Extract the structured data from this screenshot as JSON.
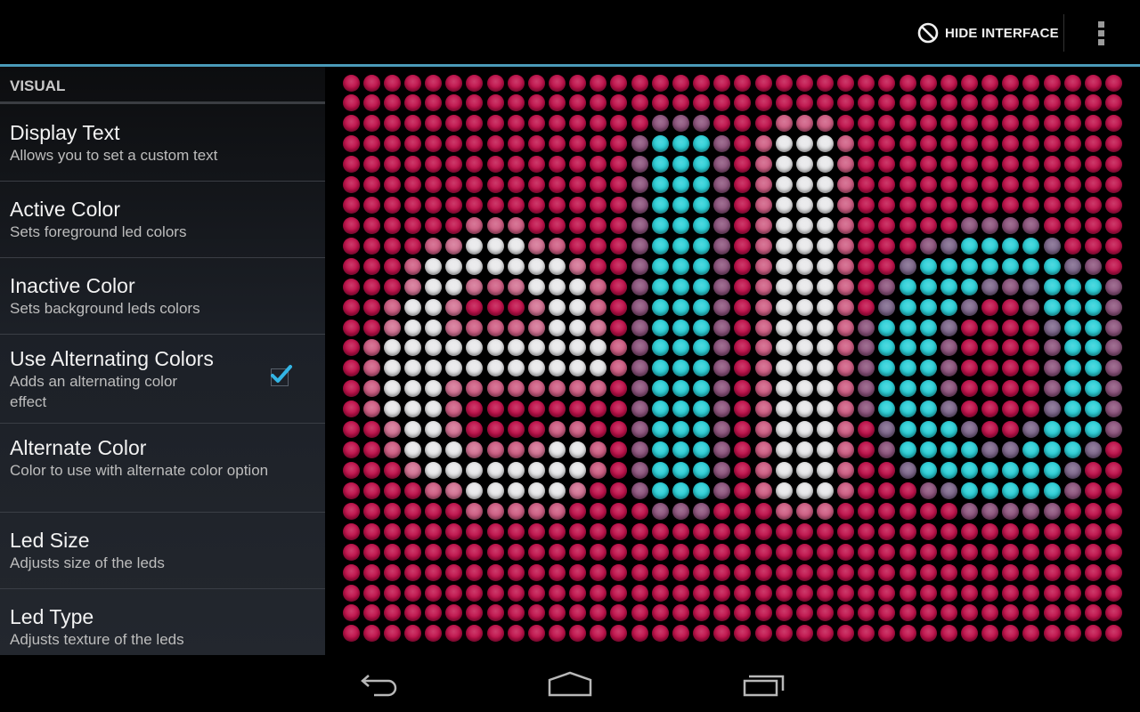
{
  "action_bar": {
    "hide_interface_label": "HIDE INTERFACE",
    "hide_icon": "block-icon",
    "overflow_icon": "more-vert-icon",
    "accent_line_color": "#4a9ab8"
  },
  "settings": {
    "category": "VISUAL",
    "items": [
      {
        "title": "Display Text",
        "summary": "Allows you to set a custom text"
      },
      {
        "title": "Active Color",
        "summary": "Sets foreground led colors"
      },
      {
        "title": "Inactive Color",
        "summary": "Sets background leds colors"
      },
      {
        "title": "Use Alternating Colors",
        "summary": "Adds an alternating color effect",
        "checked": true
      },
      {
        "title": "Alternate Color",
        "summary": "Color to use with alternate color option"
      },
      {
        "title": "Led Size",
        "summary": "Adjusts size of the leds"
      },
      {
        "title": "Led Type",
        "summary": "Adjusts texture of the leds"
      }
    ],
    "checkbox_color": "#33b5e5"
  },
  "led_display": {
    "columns": 38,
    "rows": 28,
    "colors": {
      "inactive": "#c0104a",
      "active": "#e8e8ea",
      "alternate": "#2ad0d8"
    },
    "glyphs": [
      {
        "char": "a",
        "color": "active",
        "on": [
          [
            8,
            6
          ],
          [
            8,
            7
          ],
          [
            8,
            8
          ],
          [
            9,
            4
          ],
          [
            9,
            5
          ],
          [
            9,
            6
          ],
          [
            9,
            7
          ],
          [
            9,
            8
          ],
          [
            9,
            9
          ],
          [
            9,
            10
          ],
          [
            10,
            4
          ],
          [
            10,
            5
          ],
          [
            10,
            9
          ],
          [
            10,
            10
          ],
          [
            10,
            11
          ],
          [
            11,
            3
          ],
          [
            11,
            4
          ],
          [
            11,
            10
          ],
          [
            11,
            11
          ],
          [
            12,
            3
          ],
          [
            12,
            4
          ],
          [
            12,
            10
          ],
          [
            12,
            11
          ],
          [
            13,
            2
          ],
          [
            13,
            3
          ],
          [
            13,
            4
          ],
          [
            13,
            5
          ],
          [
            13,
            6
          ],
          [
            13,
            7
          ],
          [
            13,
            8
          ],
          [
            13,
            9
          ],
          [
            13,
            10
          ],
          [
            13,
            11
          ],
          [
            13,
            12
          ],
          [
            14,
            2
          ],
          [
            14,
            3
          ],
          [
            14,
            4
          ],
          [
            14,
            5
          ],
          [
            14,
            6
          ],
          [
            14,
            7
          ],
          [
            14,
            8
          ],
          [
            14,
            9
          ],
          [
            14,
            10
          ],
          [
            14,
            11
          ],
          [
            14,
            12
          ],
          [
            15,
            2
          ],
          [
            15,
            3
          ],
          [
            15,
            4
          ],
          [
            16,
            2
          ],
          [
            16,
            3
          ],
          [
            16,
            4
          ],
          [
            17,
            3
          ],
          [
            17,
            4
          ],
          [
            18,
            3
          ],
          [
            18,
            4
          ],
          [
            18,
            5
          ],
          [
            18,
            10
          ],
          [
            18,
            11
          ],
          [
            19,
            4
          ],
          [
            19,
            5
          ],
          [
            19,
            6
          ],
          [
            19,
            7
          ],
          [
            19,
            8
          ],
          [
            19,
            9
          ],
          [
            19,
            10
          ],
          [
            19,
            11
          ],
          [
            20,
            6
          ],
          [
            20,
            7
          ],
          [
            20,
            8
          ],
          [
            20,
            9
          ],
          [
            20,
            10
          ]
        ]
      },
      {
        "char": "i",
        "color": "alternate",
        "col_range": [
          15,
          17
        ],
        "row_range": [
          3,
          20
        ]
      },
      {
        "char": "l",
        "color": "active",
        "col_range": [
          21,
          23
        ],
        "row_range": [
          3,
          20
        ]
      },
      {
        "char": "o",
        "color": "alternate",
        "on": [
          [
            8,
            30
          ],
          [
            8,
            31
          ],
          [
            8,
            32
          ],
          [
            8,
            33
          ],
          [
            9,
            28
          ],
          [
            9,
            29
          ],
          [
            9,
            30
          ],
          [
            9,
            31
          ],
          [
            9,
            32
          ],
          [
            9,
            33
          ],
          [
            9,
            34
          ],
          [
            10,
            27
          ],
          [
            10,
            28
          ],
          [
            10,
            29
          ],
          [
            10,
            30
          ],
          [
            10,
            34
          ],
          [
            10,
            35
          ],
          [
            10,
            36
          ],
          [
            11,
            27
          ],
          [
            11,
            28
          ],
          [
            11,
            29
          ],
          [
            11,
            34
          ],
          [
            11,
            35
          ],
          [
            11,
            36
          ],
          [
            12,
            26
          ],
          [
            12,
            27
          ],
          [
            12,
            28
          ],
          [
            12,
            35
          ],
          [
            12,
            36
          ],
          [
            13,
            26
          ],
          [
            13,
            27
          ],
          [
            13,
            28
          ],
          [
            13,
            35
          ],
          [
            13,
            36
          ],
          [
            14,
            26
          ],
          [
            14,
            27
          ],
          [
            14,
            28
          ],
          [
            14,
            35
          ],
          [
            14,
            36
          ],
          [
            15,
            26
          ],
          [
            15,
            27
          ],
          [
            15,
            28
          ],
          [
            15,
            35
          ],
          [
            15,
            36
          ],
          [
            16,
            26
          ],
          [
            16,
            27
          ],
          [
            16,
            28
          ],
          [
            16,
            35
          ],
          [
            16,
            36
          ],
          [
            17,
            27
          ],
          [
            17,
            28
          ],
          [
            17,
            29
          ],
          [
            17,
            34
          ],
          [
            17,
            35
          ],
          [
            17,
            36
          ],
          [
            18,
            27
          ],
          [
            18,
            28
          ],
          [
            18,
            29
          ],
          [
            18,
            30
          ],
          [
            18,
            33
          ],
          [
            18,
            34
          ],
          [
            18,
            35
          ],
          [
            19,
            28
          ],
          [
            19,
            29
          ],
          [
            19,
            30
          ],
          [
            19,
            31
          ],
          [
            19,
            32
          ],
          [
            19,
            33
          ],
          [
            19,
            34
          ],
          [
            20,
            30
          ],
          [
            20,
            31
          ],
          [
            20,
            32
          ],
          [
            20,
            33
          ],
          [
            20,
            34
          ]
        ]
      }
    ]
  },
  "nav_bar": {
    "back_icon": "back-icon",
    "home_icon": "home-icon",
    "recents_icon": "recent-apps-icon"
  }
}
